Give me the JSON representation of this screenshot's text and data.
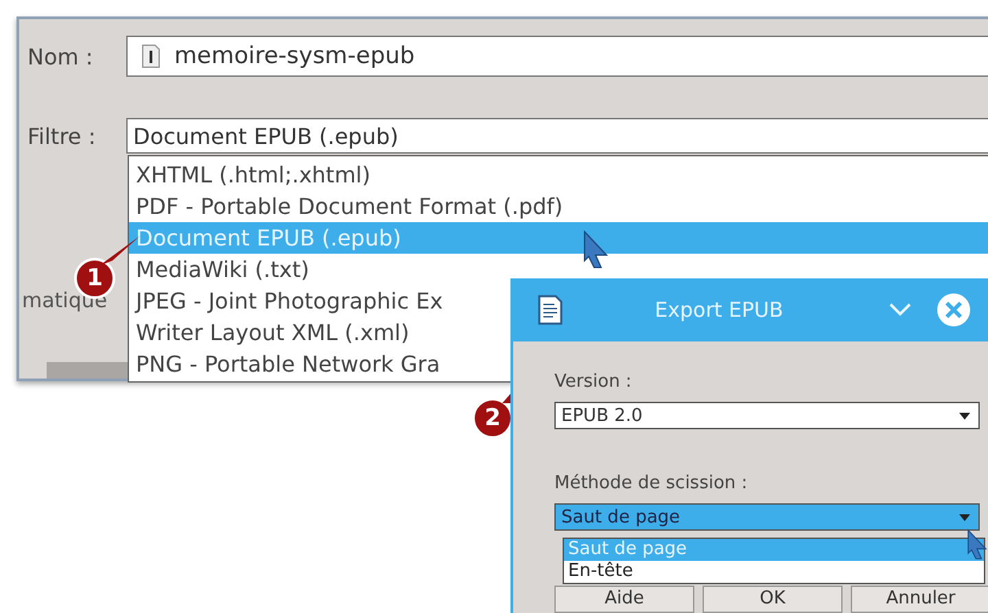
{
  "main_dialog": {
    "name_label": "Nom :",
    "name_value": "memoire-sysm-epub",
    "filter_label": "Filtre :",
    "filter_value": "Document EPUB (.epub)",
    "hidden_label": "matique",
    "filter_options": [
      {
        "label": "XHTML (.html;.xhtml)",
        "selected": false
      },
      {
        "label": "PDF - Portable Document Format (.pdf)",
        "selected": false
      },
      {
        "label": "Document EPUB (.epub)",
        "selected": true
      },
      {
        "label": "MediaWiki (.txt)",
        "selected": false
      },
      {
        "label": "JPEG - Joint Photographic Ex",
        "selected": false
      },
      {
        "label": "Writer Layout XML (.xml)",
        "selected": false
      },
      {
        "label": "PNG - Portable Network Gra",
        "selected": false
      }
    ]
  },
  "callouts": [
    "1",
    "2"
  ],
  "export_dialog": {
    "title": "Export EPUB",
    "version_label": "Version :",
    "version_value": "EPUB 2.0",
    "split_label": "Méthode de scission :",
    "split_value": "Saut de page",
    "split_options": [
      {
        "label": "Saut de page",
        "selected": true
      },
      {
        "label": "En-tête",
        "selected": false
      }
    ],
    "buttons": [
      "Aide",
      "OK",
      "Annuler"
    ]
  }
}
